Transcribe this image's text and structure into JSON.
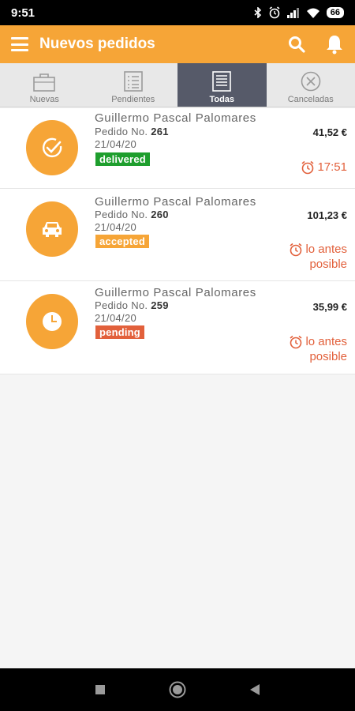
{
  "status_bar": {
    "time": "9:51",
    "battery": "66"
  },
  "app_bar": {
    "title": "Nuevos pedidos"
  },
  "tabs": [
    {
      "label": "Nuevas"
    },
    {
      "label": "Pendientes"
    },
    {
      "label": "Todas"
    },
    {
      "label": "Canceladas"
    }
  ],
  "orders": [
    {
      "customer": "Guillermo Pascal Palomares",
      "number_label": "Pedido No.",
      "number": "261",
      "date": "21/04/20",
      "status": "delivered",
      "status_color": "#1e9e2d",
      "amount": "41,52 €",
      "eta": "17:51",
      "icon": "check-icon"
    },
    {
      "customer": "Guillermo Pascal Palomares",
      "number_label": "Pedido No.",
      "number": "260",
      "date": "21/04/20",
      "status": "accepted",
      "status_color": "#f6a537",
      "amount": "101,23 €",
      "eta_line1": "lo antes",
      "eta_line2": "posible",
      "icon": "car-icon"
    },
    {
      "customer": "Guillermo Pascal Palomares",
      "number_label": "Pedido No.",
      "number": "259",
      "date": "21/04/20",
      "status": "pending",
      "status_color": "#e2603b",
      "amount": "35,99 €",
      "eta_line1": "lo antes",
      "eta_line2": "posible",
      "icon": "clock-icon"
    }
  ],
  "colors": {
    "accent": "#f6a537",
    "active_tab": "#565a69",
    "eta": "#e2603b"
  }
}
